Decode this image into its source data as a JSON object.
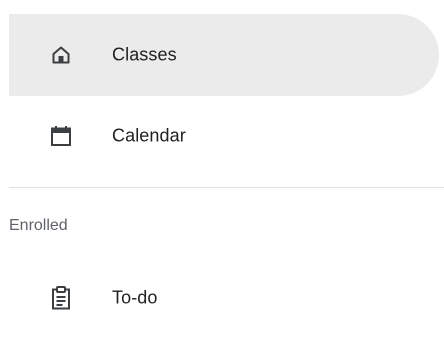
{
  "nav": {
    "items": [
      {
        "label": "Classes",
        "icon": "home-icon",
        "active": true
      },
      {
        "label": "Calendar",
        "icon": "calendar-icon",
        "active": false
      }
    ],
    "sections": [
      {
        "title": "Enrolled",
        "items": [
          {
            "label": "To-do",
            "icon": "clipboard-icon",
            "active": false
          }
        ]
      }
    ]
  },
  "colors": {
    "active_background": "#ebebeb",
    "text": "#202124",
    "section_header_text": "#5f6368",
    "divider": "#e0e0e0"
  }
}
